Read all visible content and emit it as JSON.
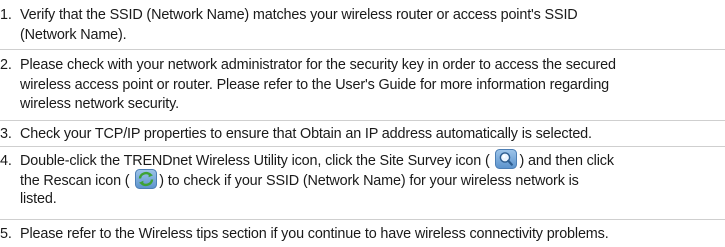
{
  "steps": [
    {
      "number": "1.",
      "lines": [
        "Verify that the SSID (Network Name)  matches your wireless router or access point's SSID",
        "(Network Name)."
      ]
    },
    {
      "number": "2.",
      "lines": [
        "Please check with your network administrator for the security key in order to access the secured",
        "wireless access point or router. Please refer to the User's Guide for more information regarding",
        "wireless network security."
      ]
    },
    {
      "number": "3.",
      "lines": [
        "Check your TCP/IP properties to ensure that Obtain an IP address automatically is selected."
      ]
    },
    {
      "number": "4.",
      "line1_a": "Double-click the TRENDnet Wireless Utility icon, click the Site Survey icon (",
      "line1_b": ") and then click",
      "line2_a": "the Rescan icon (",
      "line2_b": ")  to check if your SSID (Network Name) for your wireless network is",
      "line3": "listed."
    },
    {
      "number": "5.",
      "lines": [
        "Please refer to the Wireless tips section if you continue to have wireless connectivity problems."
      ]
    }
  ],
  "icons": {
    "site_survey": "magnifier-search-icon",
    "rescan": "refresh-arrows-icon"
  }
}
